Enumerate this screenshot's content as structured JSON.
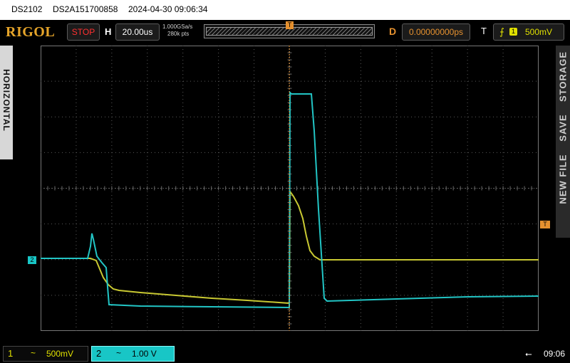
{
  "titlebar": {
    "model": "DS2102",
    "serial": "DS2A151700858",
    "datetime": "2024-04-30  09:06:34"
  },
  "status": {
    "brand": "RIGOL",
    "run_state": "STOP",
    "horizontal_label": "H",
    "timebase": "20.00us",
    "sample_rate": "1.000GSa/s",
    "memory_depth": "280k pts",
    "delay_label": "D",
    "delay": "0.00000000ps",
    "trigger_label": "T",
    "trigger_source": "1",
    "trigger_level": "500mV",
    "trigger_position_marker": "T"
  },
  "side": {
    "left_label": "HORIZONTAL",
    "right_labels": [
      "NEW FILE",
      "SAVE",
      "STORAGE"
    ]
  },
  "markers": {
    "ch2": "2",
    "trigger_level": "T"
  },
  "channels": [
    {
      "number": "1",
      "coupling": "~",
      "scale": "500mV",
      "color": "#e0e000"
    },
    {
      "number": "2",
      "coupling": "~",
      "scale": "1.00 V",
      "color": "#18c6c6"
    }
  ],
  "bottom": {
    "time": "09:06"
  },
  "colors": {
    "ch1": "#c8c832",
    "ch2": "#22c5c5",
    "trigger": "#e6912f",
    "grid": "#5a5a5a"
  }
}
